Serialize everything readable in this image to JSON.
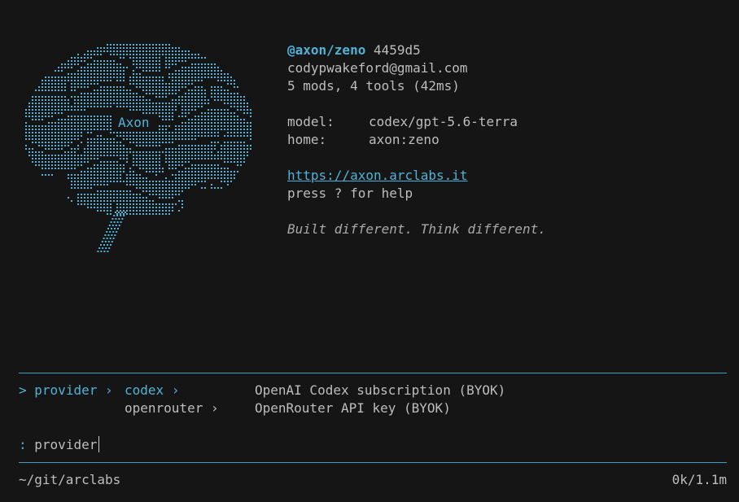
{
  "logo": {
    "label": "Axon",
    "icon_name": "brain-ascii-icon"
  },
  "info": {
    "handle": "@axon/zeno",
    "hash": "4459d5",
    "email": "codypwakeford@gmail.com",
    "stats": "5 mods, 4 tools (42ms)",
    "model_key": "model:",
    "model_value": "codex/gpt-5.6-terra",
    "home_key": "home:",
    "home_value": "axon:zeno",
    "url": "https://axon.arclabs.it",
    "help": "press ? for help",
    "tagline": "Built different. Think different."
  },
  "menu": {
    "prompt": ">",
    "crumb": "provider",
    "sep": "›",
    "items": [
      {
        "label": "codex",
        "arrow": "›",
        "description": "OpenAI Codex subscription (BYOK)"
      },
      {
        "label": "openrouter",
        "arrow": "›",
        "description": "OpenRouter API key (BYOK)"
      }
    ]
  },
  "input": {
    "prefix": ":",
    "value": "provider"
  },
  "status": {
    "path": "~/git/arclabs",
    "tokens": "0k/1.1m"
  },
  "colors": {
    "background": "#151515",
    "accent": "#4fb3d9",
    "text": "#bdbdbd"
  }
}
